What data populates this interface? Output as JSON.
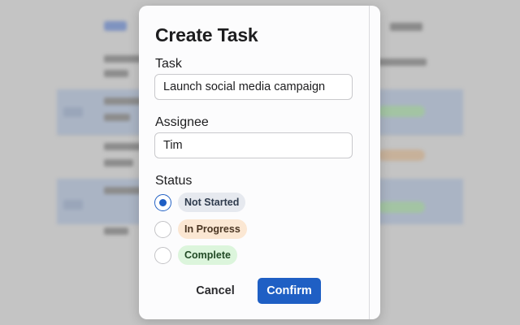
{
  "modal": {
    "title": "Create Task",
    "task": {
      "label": "Task",
      "value": "Launch social media campaign"
    },
    "assignee": {
      "label": "Assignee",
      "value": "Tim"
    },
    "status": {
      "label": "Status",
      "selected": "Not Started",
      "options": [
        {
          "label": "Not Started",
          "bg": "#e6e9ef",
          "fg": "#2f3b4d"
        },
        {
          "label": "In Progress",
          "bg": "#fbe7d3",
          "fg": "#4a3522"
        },
        {
          "label": "Complete",
          "bg": "#dcf5dc",
          "fg": "#214a25"
        }
      ]
    },
    "cancel_label": "Cancel",
    "confirm_label": "Confirm"
  },
  "colors": {
    "accent": "#1f5fc4",
    "overlay": "#c4c4c4"
  }
}
